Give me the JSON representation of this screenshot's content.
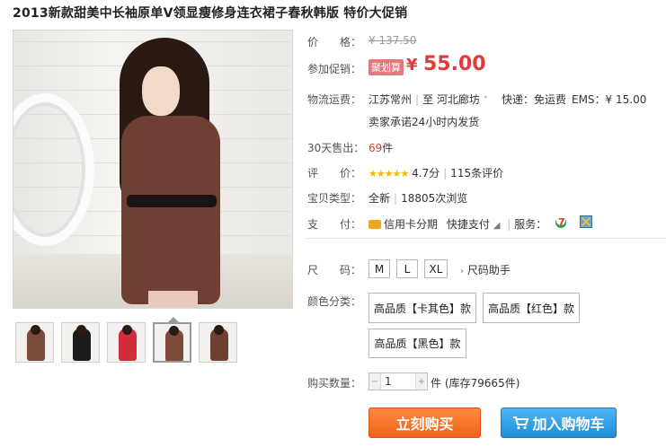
{
  "title": "2013新款甜美中长袖原单V领显瘦修身连衣裙子春秋韩版 特价大促销",
  "price": {
    "label": "价　　格：",
    "original": "¥ 137.50"
  },
  "promo": {
    "label": "参加促销：",
    "badge": "聚划算",
    "currency": "¥",
    "price": "55.00"
  },
  "shipping": {
    "label": "物流运费：",
    "from": "江苏常州",
    "to_prefix": "至",
    "to": "河北廊坊",
    "express": "快递：免运费",
    "ems": "EMS：¥ 15.00",
    "promise": "卖家承诺24小时内发货"
  },
  "sales": {
    "label": "30天售出：",
    "count": "69",
    "unit": "件"
  },
  "rating": {
    "label": "评　　价：",
    "stars": "★★★★★",
    "score": "4.7分",
    "reviews": "115条评价"
  },
  "item_type": {
    "label": "宝贝类型：",
    "condition": "全新",
    "views": "18805次浏览"
  },
  "payment": {
    "label": "支　　付：",
    "credit": "信用卡分期",
    "quick": "快捷支付",
    "service_label": "服务："
  },
  "size": {
    "label": "尺　　码：",
    "options": [
      "M",
      "L",
      "XL"
    ],
    "helper": "尺码助手"
  },
  "color": {
    "label": "颜色分类：",
    "options": [
      "高品质【卡其色】款",
      "高品质【红色】款",
      "高品质【黑色】款"
    ]
  },
  "quantity": {
    "label": "购买数量：",
    "value": "1",
    "unit": "件",
    "stock": "(库存79665件)"
  },
  "actions": {
    "buy": "立刻购买",
    "cart": "加入购物车"
  },
  "thumbs": [
    {
      "color": "#7a4a3a"
    },
    {
      "color": "#1a1a1a"
    },
    {
      "color": "#d22b3a"
    },
    {
      "color": "#7a4a3a"
    },
    {
      "color": "#6e3f33"
    }
  ]
}
